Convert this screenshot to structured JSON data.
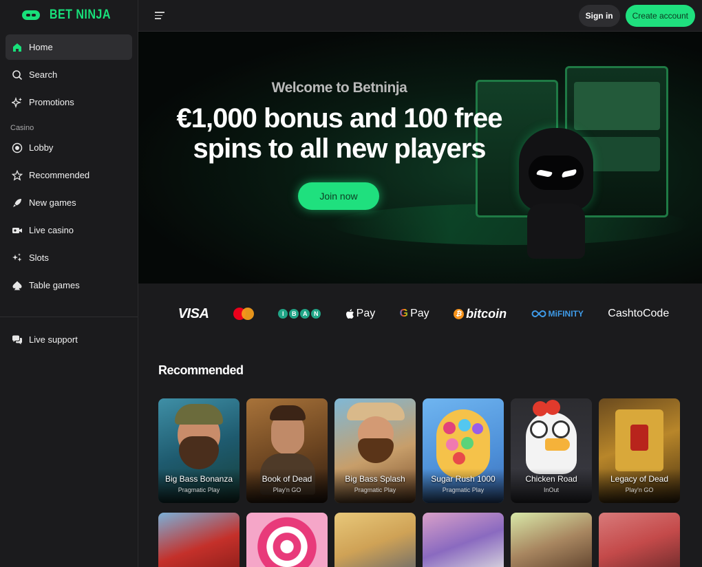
{
  "brand": {
    "name": "BET NINJA",
    "accent": "#18e07a"
  },
  "sidebar": {
    "items": [
      {
        "label": "Home",
        "icon": "home-icon",
        "active": true
      },
      {
        "label": "Search",
        "icon": "search-icon"
      },
      {
        "label": "Promotions",
        "icon": "sparkle-icon"
      }
    ],
    "casino_label": "Casino",
    "casino_items": [
      {
        "label": "Lobby",
        "icon": "chip-icon"
      },
      {
        "label": "Recommended",
        "icon": "star-icon"
      },
      {
        "label": "New games",
        "icon": "rocket-icon"
      },
      {
        "label": "Live casino",
        "icon": "camera-icon"
      },
      {
        "label": "Slots",
        "icon": "sparkles-icon"
      },
      {
        "label": "Table games",
        "icon": "spade-icon"
      }
    ],
    "support_label": "Live support"
  },
  "topbar": {
    "signin_label": "Sign in",
    "create_label": "Create account"
  },
  "hero": {
    "welcome": "Welcome to Betninja",
    "title_line1": "€1,000 bonus and 100 free",
    "title_line2": "spins to all new players",
    "cta": "Join now"
  },
  "payments": {
    "visa": "VISA",
    "iban": [
      "I",
      "B",
      "A",
      "N"
    ],
    "applepay": "Pay",
    "googlepay": "Pay",
    "bitcoin": "bitcoin",
    "mifinity": "MiFINITY",
    "cashtocode": "CashtoCode"
  },
  "recommended": {
    "title": "Recommended",
    "games": [
      {
        "name": "Big Bass Bonanza",
        "provider": "Pragmatic Play"
      },
      {
        "name": "Book of Dead",
        "provider": "Play'n GO"
      },
      {
        "name": "Big Bass Splash",
        "provider": "Pragmatic Play"
      },
      {
        "name": "Sugar Rush 1000",
        "provider": "Pragmatic Play"
      },
      {
        "name": "Chicken Road",
        "provider": "InOut"
      },
      {
        "name": "Legacy of Dead",
        "provider": "Play'n GO"
      }
    ]
  }
}
